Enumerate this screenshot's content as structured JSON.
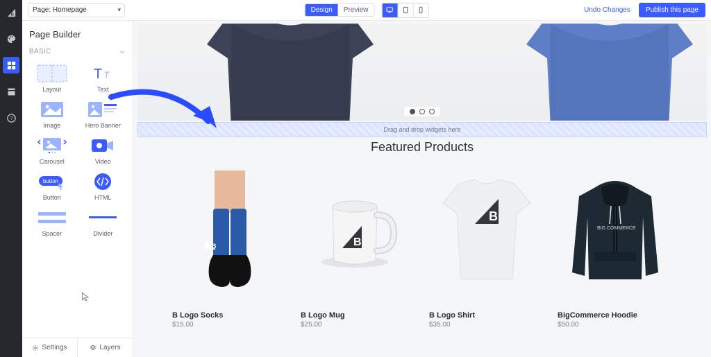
{
  "rail": {
    "items": [
      "logo",
      "palette",
      "widgets",
      "storefront",
      "help"
    ]
  },
  "topbar": {
    "page_selector": "Page: Homepage",
    "modes": {
      "design": "Design",
      "preview": "Preview"
    },
    "undo": "Undo Changes",
    "publish": "Publish this page"
  },
  "sidebar": {
    "title": "Page Builder",
    "section_label": "BASIC",
    "widgets": [
      {
        "label": "Layout"
      },
      {
        "label": "Text"
      },
      {
        "label": "Image"
      },
      {
        "label": "Hero Banner"
      },
      {
        "label": "Carousel"
      },
      {
        "label": "Video"
      },
      {
        "label": "Button"
      },
      {
        "label": "HTML"
      },
      {
        "label": "Spacer"
      },
      {
        "label": "Divider"
      }
    ],
    "footer": {
      "settings": "Settings",
      "layers": "Layers"
    }
  },
  "canvas": {
    "drop_hint": "Drag and drop widgets here",
    "featured_title": "Featured Products",
    "products": [
      {
        "name": "B Logo Socks",
        "price": "$15.00"
      },
      {
        "name": "B Logo Mug",
        "price": "$25.00"
      },
      {
        "name": "B Logo Shirt",
        "price": "$35.00"
      },
      {
        "name": "BigCommerce Hoodie",
        "price": "$50.00"
      }
    ]
  }
}
